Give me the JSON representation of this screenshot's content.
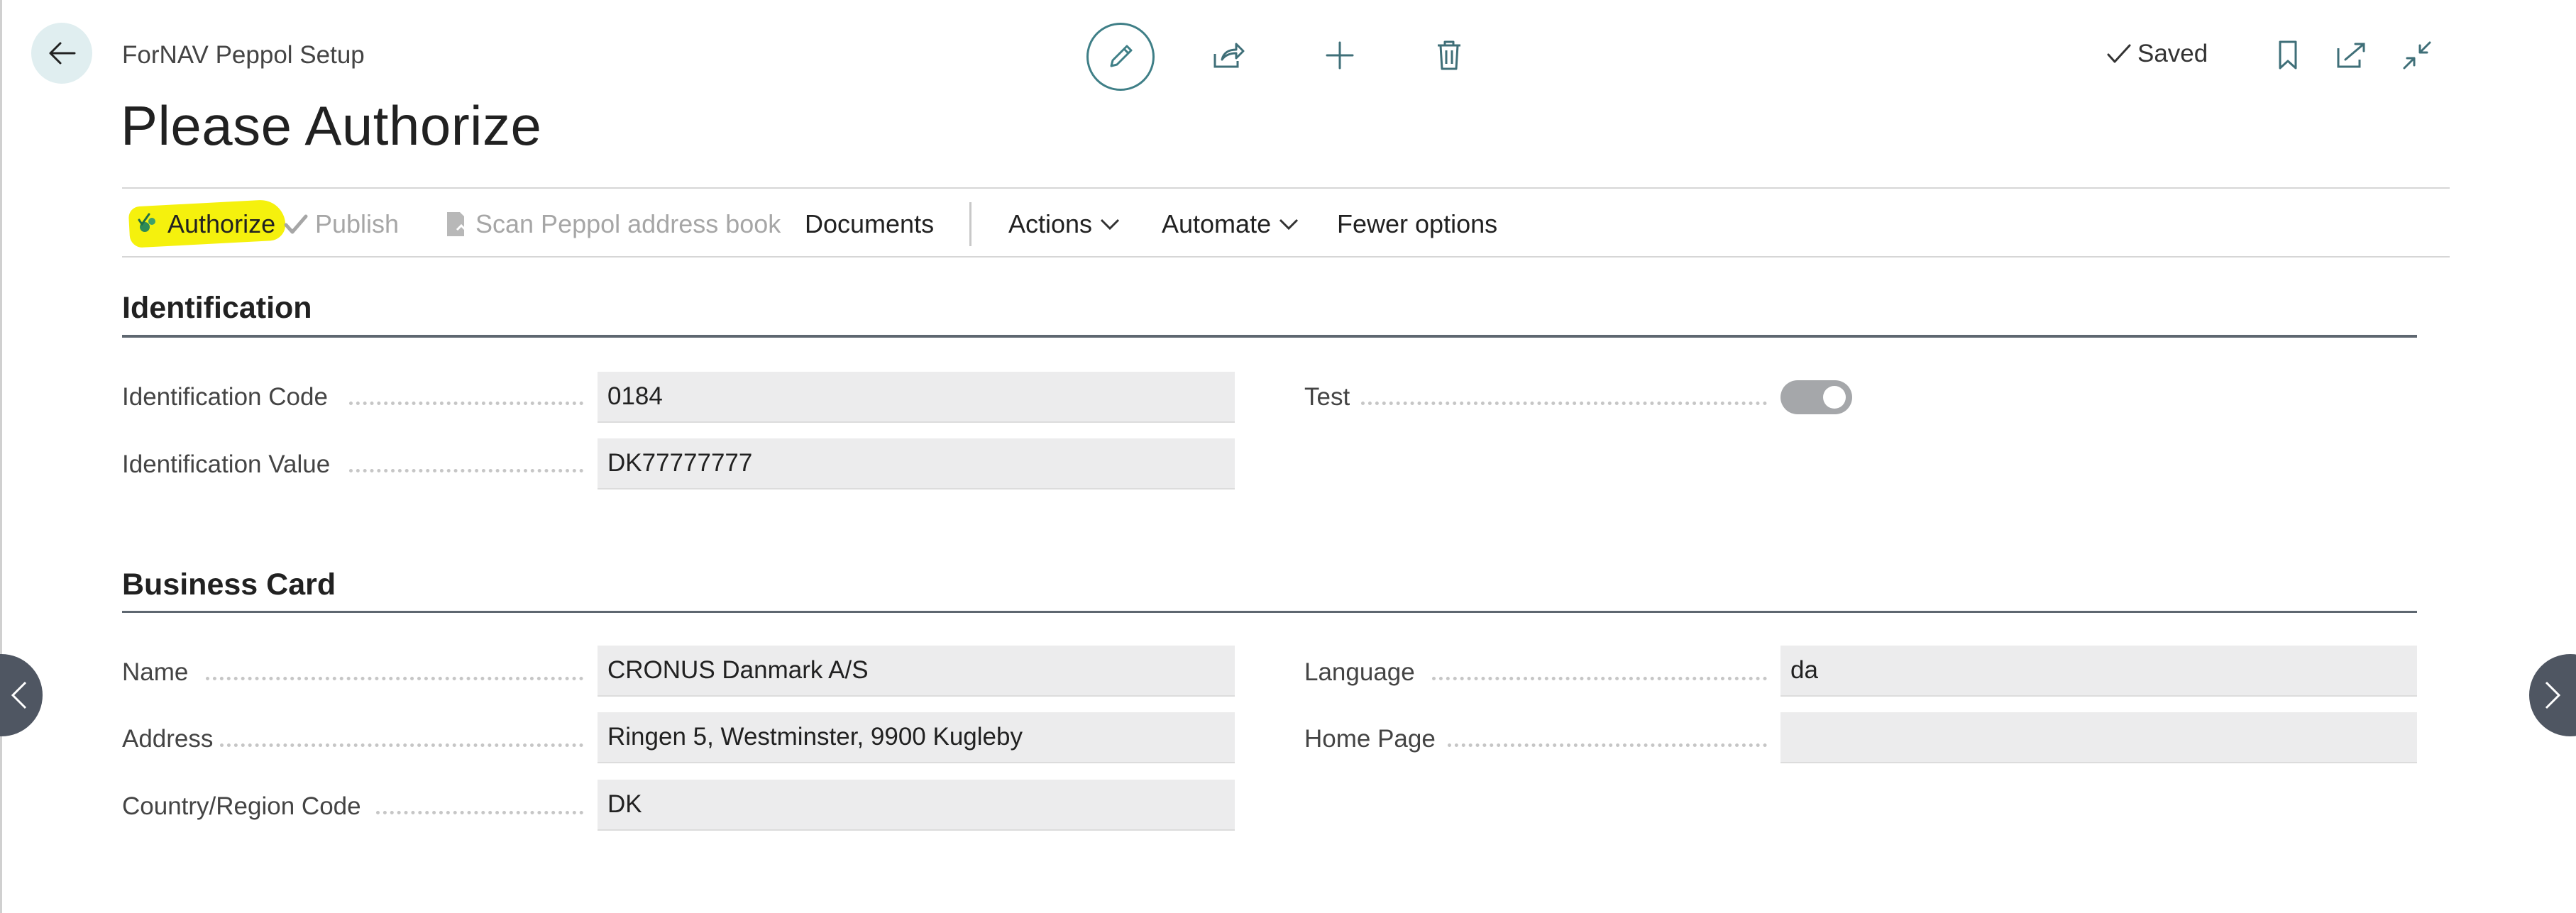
{
  "header": {
    "breadcrumb": "ForNAV Peppol Setup",
    "title": "Please Authorize",
    "status": "Saved"
  },
  "actions": {
    "authorize": "Authorize",
    "publish": "Publish",
    "scan": "Scan Peppol address book",
    "documents": "Documents",
    "actions_menu": "Actions",
    "automate": "Automate",
    "fewer_options": "Fewer options"
  },
  "identification": {
    "title": "Identification",
    "code_label": "Identification Code",
    "code_value": "0184",
    "value_label": "Identification Value",
    "value_value": "DK77777777",
    "test_label": "Test",
    "test_enabled": true
  },
  "business_card": {
    "title": "Business Card",
    "name_label": "Name",
    "name_value": "CRONUS Danmark A/S",
    "address_label": "Address",
    "address_value": "Ringen 5, Westminster, 9900 Kugleby",
    "country_label": "Country/Region Code",
    "country_value": "DK",
    "language_label": "Language",
    "language_value": "da",
    "homepage_label": "Home Page",
    "homepage_value": ""
  },
  "colors": {
    "accent": "#3f7f87",
    "highlight": "#f4f000",
    "field_bg": "#ececed",
    "section_line": "#5e6770",
    "nav_button": "#4f5662"
  },
  "icons": [
    "back-arrow-icon",
    "pencil-icon",
    "share-icon",
    "plus-icon",
    "trash-icon",
    "checkmark-icon",
    "bookmark-icon",
    "open-new-window-icon",
    "collapse-icon",
    "authorize-icon",
    "scan-document-icon",
    "chevron-down-icon",
    "chevron-left-icon",
    "chevron-right-icon"
  ]
}
